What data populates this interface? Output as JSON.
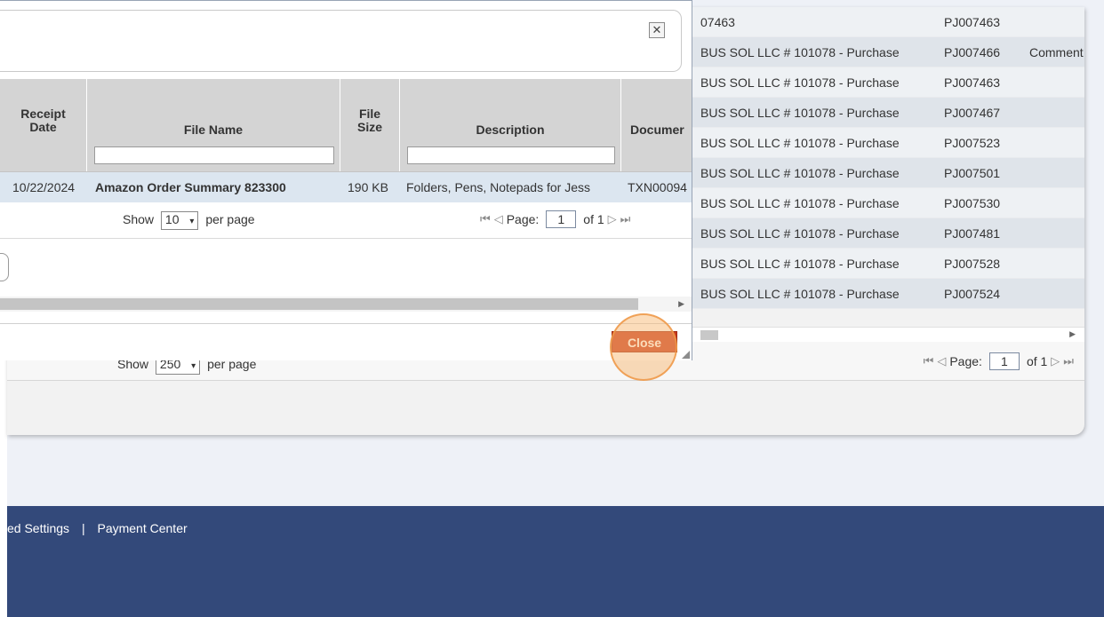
{
  "background_table": {
    "first_row": {
      "vendor": "07463",
      "ref": "PJ007463",
      "extra": ""
    },
    "rows": [
      {
        "vendor": "BUS SOL LLC # 101078 - Purchase",
        "ref": "PJ007466",
        "extra": "Comment"
      },
      {
        "vendor": "BUS SOL LLC # 101078 - Purchase",
        "ref": "PJ007463",
        "extra": ""
      },
      {
        "vendor": "BUS SOL LLC # 101078 - Purchase",
        "ref": "PJ007467",
        "extra": ""
      },
      {
        "vendor": "BUS SOL LLC # 101078 - Purchase",
        "ref": "PJ007523",
        "extra": ""
      },
      {
        "vendor": "BUS SOL LLC # 101078 - Purchase",
        "ref": "PJ007501",
        "extra": ""
      },
      {
        "vendor": "BUS SOL LLC # 101078 - Purchase",
        "ref": "PJ007530",
        "extra": ""
      },
      {
        "vendor": "BUS SOL LLC # 101078 - Purchase",
        "ref": "PJ007481",
        "extra": ""
      },
      {
        "vendor": "BUS SOL LLC # 101078 - Purchase",
        "ref": "PJ007528",
        "extra": ""
      },
      {
        "vendor": "BUS SOL LLC # 101078 - Purchase",
        "ref": "PJ007524",
        "extra": ""
      }
    ],
    "pager": {
      "show_label": "Show",
      "per_page_value": "250",
      "per_page_label": "per page",
      "page_label": "Page:",
      "page_value": "1",
      "of_label": "of 1"
    }
  },
  "modal": {
    "close_x_glyph": "✕",
    "columns": [
      {
        "key": "receipt_date",
        "label": "Receipt\nDate",
        "filter": false
      },
      {
        "key": "file_name",
        "label": "File Name",
        "filter": true
      },
      {
        "key": "file_size",
        "label": "File\nSize",
        "filter": false
      },
      {
        "key": "description",
        "label": "Description",
        "filter": true
      },
      {
        "key": "document",
        "label": "Documer",
        "filter": false
      }
    ],
    "row": {
      "receipt_date": "10/22/2024",
      "file_name": "Amazon Order Summary 823300",
      "file_size": "190 KB",
      "description": "Folders, Pens, Notepads for Jess",
      "document": "TXN00094"
    },
    "pager": {
      "show_label": "Show",
      "per_page_value": "10",
      "per_page_label": "per page",
      "page_label": "Page:",
      "page_value": "1",
      "of_label": "of 1"
    },
    "close_button_label": "Close"
  },
  "footer": {
    "links": [
      "ed Settings",
      "Payment Center"
    ],
    "separator": "|"
  },
  "icons": {
    "first_page": "⏮",
    "prev_page": "◁",
    "next_page": "▷",
    "last_page": "⏭",
    "chevron_down": "▾",
    "scroll_right": "▶"
  }
}
